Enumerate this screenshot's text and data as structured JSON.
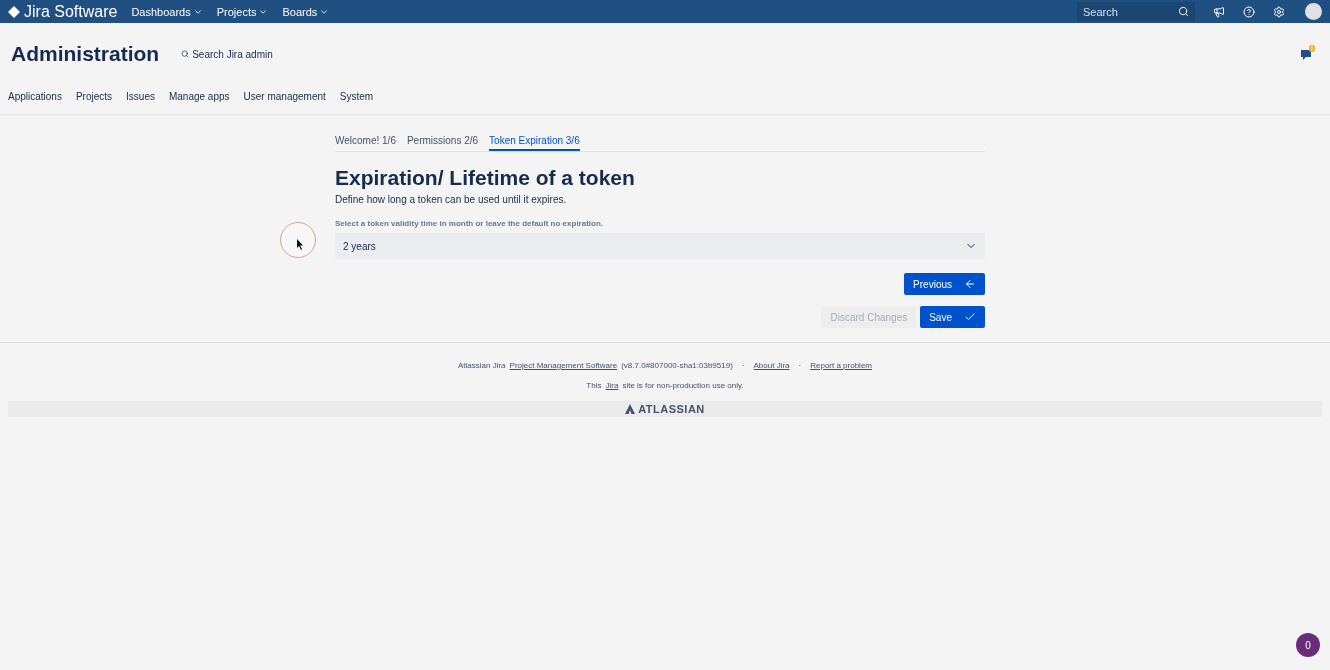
{
  "topbar": {
    "logo": "Jira Software",
    "menus": [
      "Dashboards",
      "Projects",
      "Boards"
    ],
    "search": {
      "placeholder": "Search"
    },
    "notification_badge": "!"
  },
  "header": {
    "title": "Administration",
    "search_link": "Search Jira admin"
  },
  "admin_nav": [
    "Applications",
    "Projects",
    "Issues",
    "Manage apps",
    "User management",
    "System"
  ],
  "wizard_tabs": [
    {
      "label": "Welcome! 1/6",
      "selected": false
    },
    {
      "label": "Permissions 2/6",
      "selected": false
    },
    {
      "label": "Token Expiration 3/6",
      "selected": true
    }
  ],
  "content": {
    "heading": "Expiration/ Lifetime of a token",
    "description": "Define how long a token can be used until it expires.",
    "select_label": "Select a token validity time in month or leave the default no expiration.",
    "select_value": "2 years"
  },
  "buttons": {
    "previous": "Previous",
    "discard": {
      "label": "Discard Changes",
      "disabled": true
    },
    "save": "Save"
  },
  "footer": {
    "line1": {
      "prefix": "Atlassian Jira",
      "link": "Project Management Software",
      "version": "(v8.7.0#807000-sha1:03b9519)",
      "links": [
        {
          "separator": "·",
          "label": "About Jira"
        },
        {
          "separator": "·",
          "label": "Report a problem"
        }
      ]
    },
    "line2": {
      "prefix": "This",
      "link": "Jira",
      "suffix": "site is for non-production use only."
    },
    "brand": "ATLASSIAN"
  },
  "chat_badge": "0"
}
